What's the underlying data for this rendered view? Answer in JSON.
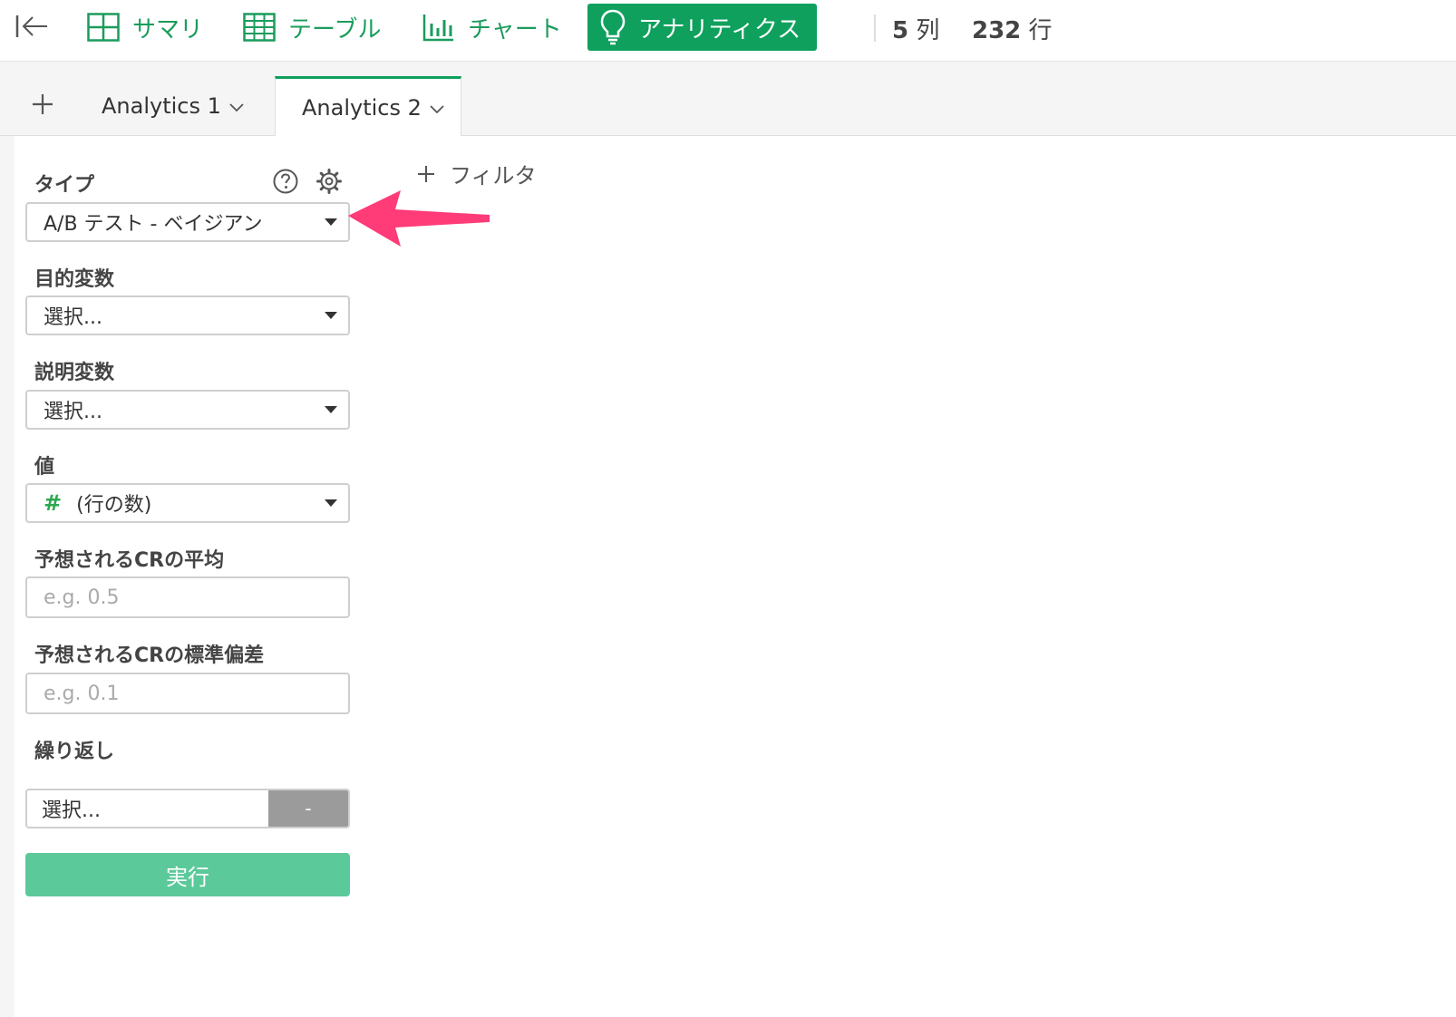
{
  "toolbar": {
    "tabs": [
      {
        "label": "サマリ",
        "icon": "summary-grid-icon"
      },
      {
        "label": "テーブル",
        "icon": "table-icon"
      },
      {
        "label": "チャート",
        "icon": "bar-chart-icon"
      },
      {
        "label": "アナリティクス",
        "icon": "lightbulb-icon",
        "active": true
      }
    ],
    "columns_count": "5",
    "columns_unit": "列",
    "rows_count": "232",
    "rows_unit": "行",
    "accent_color": "#0fa05e"
  },
  "analytics_tabs": [
    {
      "label": "Analytics 1",
      "active": false
    },
    {
      "label": "Analytics 2",
      "active": true
    }
  ],
  "form": {
    "type_label": "タイプ",
    "type_value": "A/B テスト - ベイジアン",
    "target_label": "目的変数",
    "target_value": "選択...",
    "explanatory_label": "説明変数",
    "explanatory_value": "選択...",
    "value_label": "値",
    "value_symbol": "#",
    "value_value": "(行の数)",
    "cr_mean_label": "予想されるCRの平均",
    "cr_mean_placeholder": "e.g. 0.5",
    "cr_sd_label": "予想されるCRの標準偏差",
    "cr_sd_placeholder": "e.g. 0.1",
    "repeat_label": "繰り返し",
    "repeat_value": "選択...",
    "repeat_button": "-",
    "run_button": "実行"
  },
  "filter": {
    "label": "フィルタ"
  },
  "annotation_arrow_color": "#ff3b78"
}
